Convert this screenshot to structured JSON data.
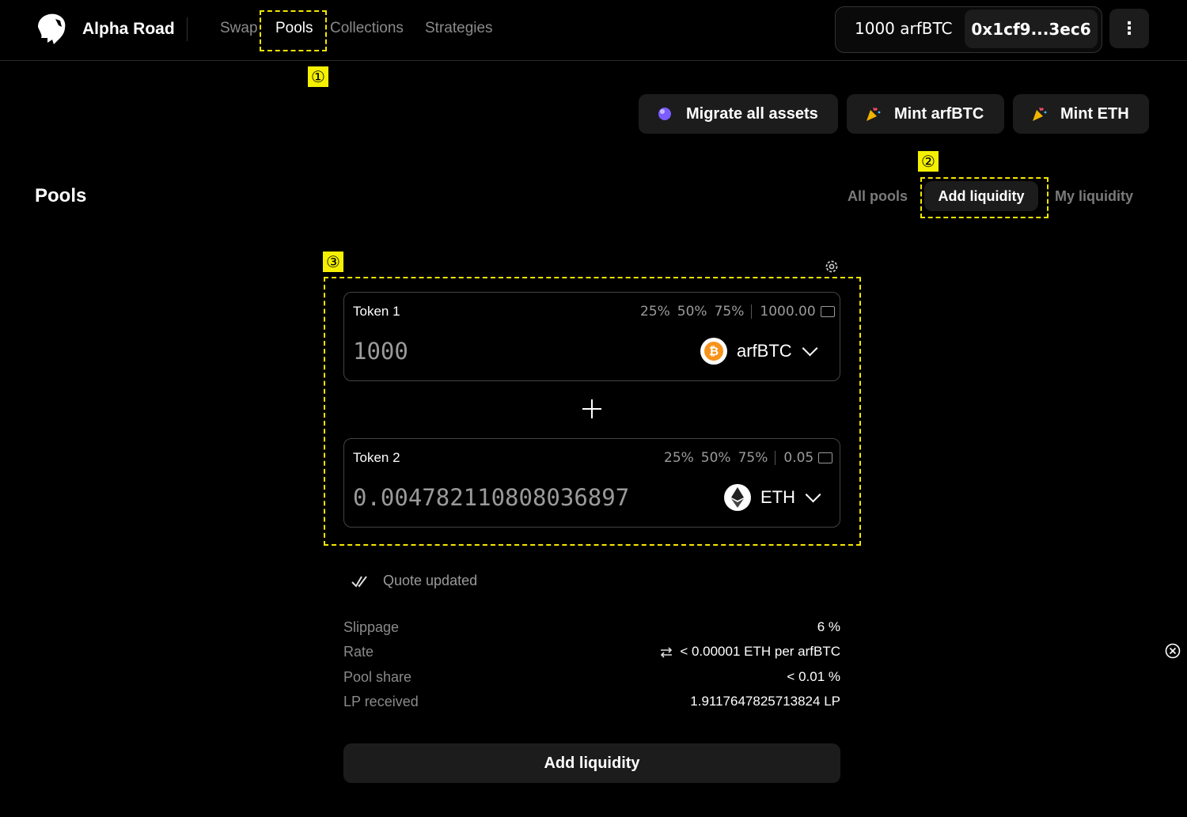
{
  "header": {
    "brand": "Alpha Road",
    "nav": [
      {
        "label": "Swap"
      },
      {
        "label": "Pools"
      },
      {
        "label": "Collections"
      },
      {
        "label": "Strategies"
      }
    ],
    "balance": "1000 arfBTC",
    "address": "0x1cf9...3ec6",
    "more_icon": "⋮"
  },
  "markers": [
    "①",
    "②",
    "③"
  ],
  "actions": [
    {
      "label": "Migrate all assets",
      "icon": "purple-orb-icon"
    },
    {
      "label": "Mint arfBTC",
      "icon": "party-popper-icon"
    },
    {
      "label": "Mint ETH",
      "icon": "party-popper-icon"
    }
  ],
  "page": {
    "title": "Pools",
    "tabs": [
      {
        "label": "All pools"
      },
      {
        "label": "Add liquidity"
      },
      {
        "label": "My liquidity"
      }
    ]
  },
  "token1": {
    "label": "Token 1",
    "pcts": [
      "25%",
      "50%",
      "75%"
    ],
    "balance": "1000.00",
    "amount": "1000",
    "symbol": "arfBTC"
  },
  "token2": {
    "label": "Token 2",
    "pcts": [
      "25%",
      "50%",
      "75%"
    ],
    "balance": "0.05",
    "amount": "0.004782110808036897",
    "symbol": "ETH"
  },
  "quote": {
    "status": "Quote updated"
  },
  "info": [
    {
      "label": "Slippage",
      "value": "6 %"
    },
    {
      "label": "Rate",
      "value": "< 0.00001 ETH per arfBTC"
    },
    {
      "label": "Pool share",
      "value": "< 0.01 %"
    },
    {
      "label": "LP received",
      "value": "1.9117647825713824 LP"
    }
  ],
  "submit_label": "Add liquidity",
  "colors": {
    "accent_marker": "#f5f000",
    "panel": "#1c1c1c",
    "bitcoin": "#f7931a"
  }
}
